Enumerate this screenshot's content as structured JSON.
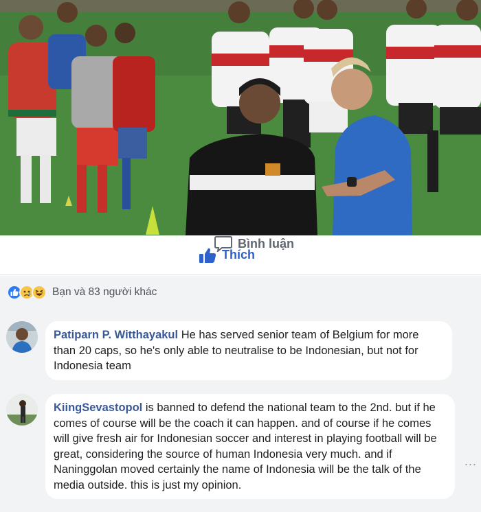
{
  "actions": {
    "like_label": "Thích",
    "comment_label": "Bình luận"
  },
  "reactions": {
    "icons": [
      "like-icon",
      "sad-icon",
      "haha-icon"
    ],
    "summary": "Bạn và 83 người khác"
  },
  "comments": [
    {
      "author": "Patiparn P. Witthayakul",
      "text": " He has served senior team of Belgium for more than 20 caps, so he's only able to neutralise to be Indonesian, but not for Indonesia team"
    },
    {
      "author": "KiingSevastopol",
      "text": " is banned to defend the national team to the 2nd. but if he comes of course will be the coach it can happen. and of course if he comes will give fresh air for Indonesian soccer and interest in playing football will be great, considering the source of human Indonesia very much. and if Naninggolan moved certainly the name of Indonesia will be the talk of the media outside. this is just my opinion."
    }
  ],
  "more_menu": "...",
  "colors": {
    "accent": "#2d62cc",
    "author": "#385898",
    "panel_bg": "#f2f3f5",
    "muted": "#606770"
  }
}
